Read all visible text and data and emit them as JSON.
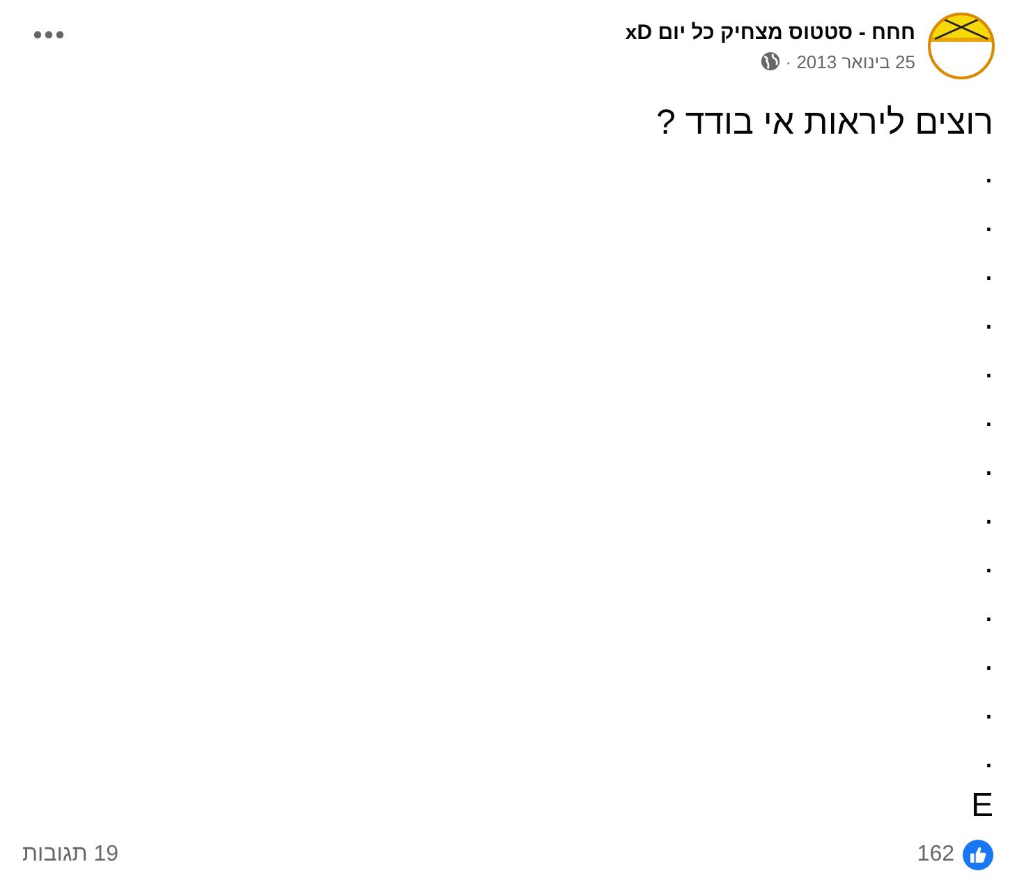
{
  "post": {
    "author": "חחח - סטטוס מצחיק כל יום xD",
    "date": "25 בינואר 2013 ·",
    "lines": [
      "רוצים ליראות אי בודד ?",
      ".",
      ".",
      ".",
      ".",
      ".",
      ".",
      ".",
      ".",
      ".",
      ".",
      ".",
      ".",
      ".",
      "E"
    ]
  },
  "footer": {
    "likes": "162",
    "comments": "19 תגובות"
  }
}
